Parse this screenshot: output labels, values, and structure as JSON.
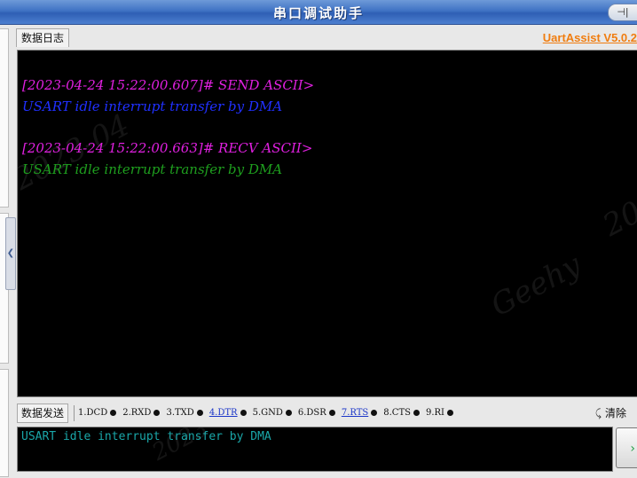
{
  "window": {
    "title": "串口调试助手",
    "pin_symbol": "⊣|"
  },
  "tabs": {
    "log_tab": "数据日志"
  },
  "version_link": "UartAssist V5.0.2",
  "log": {
    "entries": [
      {
        "header": "[2023-04-24 15:22:00.607]# SEND ASCII>",
        "body": "USART idle interrupt transfer by DMA",
        "header_color": "#e020e0",
        "body_color": "#2030ff"
      },
      {
        "header": "[2023-04-24 15:22:00.663]# RECV ASCII>",
        "body": "USART idle interrupt transfer by DMA",
        "header_color": "#e020e0",
        "body_color": "#1e9e1e"
      }
    ]
  },
  "send_bar": {
    "tab_label": "数据发送",
    "signals": [
      {
        "label": "1.DCD",
        "link": false
      },
      {
        "label": "2.RXD",
        "link": false
      },
      {
        "label": "3.TXD",
        "link": false
      },
      {
        "label": "4.DTR",
        "link": true
      },
      {
        "label": "5.GND",
        "link": false
      },
      {
        "label": "6.DSR",
        "link": false
      },
      {
        "label": "7.RTS",
        "link": true
      },
      {
        "label": "8.CTS",
        "link": false
      },
      {
        "label": "9.RI",
        "link": false
      }
    ],
    "clear_label": "清除"
  },
  "send_input": {
    "value": "USART idle interrupt transfer by DMA"
  },
  "send_button": {
    "glyph": "›"
  },
  "colors": {
    "accent_orange": "#f07d10",
    "title_blue": "#3f72c4",
    "send_text": "#1aa7a9"
  }
}
